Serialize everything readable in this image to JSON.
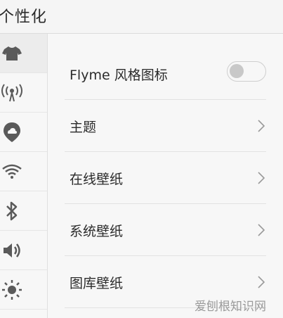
{
  "header": {
    "title": "个性化"
  },
  "sidebar": {
    "items": [
      {
        "icon": "tshirt-icon",
        "active": true
      },
      {
        "icon": "antenna-broadcast-icon",
        "active": false
      },
      {
        "icon": "cloud-location-icon",
        "active": false
      },
      {
        "icon": "wifi-icon",
        "active": false
      },
      {
        "icon": "bluetooth-icon",
        "active": false
      },
      {
        "icon": "volume-icon",
        "active": false
      },
      {
        "icon": "brightness-icon",
        "active": false
      }
    ]
  },
  "settings": {
    "items": [
      {
        "label": "Flyme 风格图标",
        "control": "toggle",
        "toggle_on": false
      },
      {
        "label": "主题",
        "control": "chevron-right-icon"
      },
      {
        "label": "在线壁纸",
        "control": "chevron-right-icon"
      },
      {
        "label": "系统壁纸",
        "control": "chevron-right-icon"
      },
      {
        "label": "图库壁纸",
        "control": "chevron-right-icon"
      }
    ]
  },
  "watermark": {
    "text": "爱刨根知识网"
  },
  "colors": {
    "background": "#f7f7f7",
    "icon": "#5a5a5a",
    "text": "#2b2b2b",
    "divider": "#e2e2e2"
  }
}
